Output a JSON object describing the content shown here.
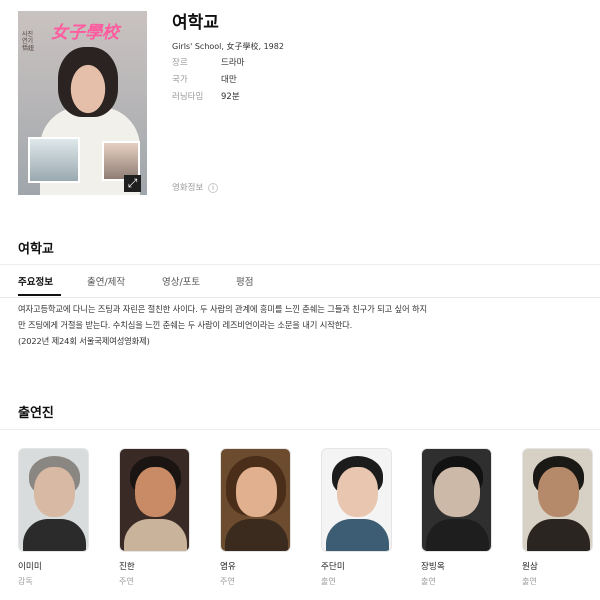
{
  "movie": {
    "title": "여학교",
    "subtitle": "Girls' School, 女子學校, 1982",
    "poster": {
      "title_text": "女子學校",
      "side_text": "사진\n연기\n恬妞",
      "expand_icon": "expand-icon"
    },
    "details": [
      {
        "key": "장르",
        "value": "드라마"
      },
      {
        "key": "국가",
        "value": "대만"
      },
      {
        "key": "러닝타임",
        "value": "92분"
      }
    ],
    "more_label": "영화정보",
    "more_icon_label": "i"
  },
  "section_title": "여학교",
  "tabs": [
    {
      "label": "주요정보",
      "active": true
    },
    {
      "label": "출연/제작",
      "active": false
    },
    {
      "label": "영상/포토",
      "active": false
    },
    {
      "label": "평점",
      "active": false
    }
  ],
  "description": {
    "line1": "여자고등학교에 다니는 즈팅과 자린은 절친한 사이다. 두 사람의 관계에 흥미를 느낀 춘쉐는 그들과 친구가 되고 싶어 하지",
    "line2": "만 즈팅에게 거절을 받는다. 수치심을 느낀 춘쉐는 두 사람이 레즈비언이라는 소문을 내기 시작한다.",
    "line3": "(2022년 제24회 서울국제여성영화제)"
  },
  "cast_title": "출연진",
  "cast": [
    {
      "name": "이미미",
      "role": "감독"
    },
    {
      "name": "진한",
      "role": "주연"
    },
    {
      "name": "염유",
      "role": "주연"
    },
    {
      "name": "주단미",
      "role": "출연"
    },
    {
      "name": "장빙옥",
      "role": "출연"
    },
    {
      "name": "원삼",
      "role": "출연"
    }
  ],
  "colors": {
    "poster_title": "#ff5b9f",
    "text_primary": "#111111",
    "text_secondary": "#9b9b9b"
  }
}
